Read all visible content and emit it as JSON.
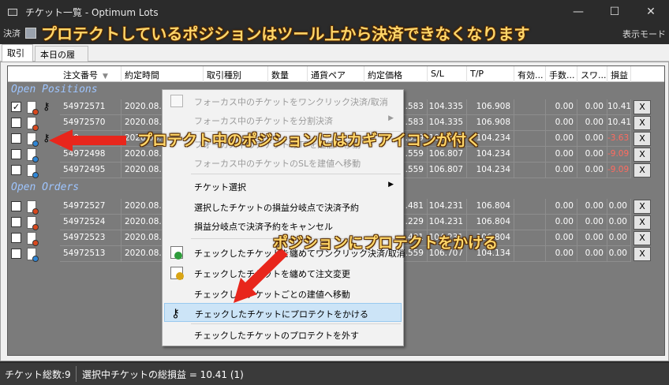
{
  "window": {
    "title": "チケット一覧 - Optimum Lots",
    "minimize": "—",
    "maximize": "☐",
    "close": "✕"
  },
  "toolbar": {
    "settle_label": "決済",
    "display_mode_label": "表示モード"
  },
  "banner_text": "プロテクトしているポジションはツール上から決済できなくなります",
  "tabs": [
    {
      "label": "取引",
      "active": true
    },
    {
      "label": "本日の履歴",
      "active": false
    }
  ],
  "columns": [
    "注文番号",
    "約定時間",
    "取引種別",
    "数量",
    "通貨ペア",
    "約定価格",
    "S/L",
    "T/P",
    "有効...",
    "手数...",
    "スワ...",
    "損益"
  ],
  "sections": {
    "open_positions": "Open Positions",
    "open_orders": "Open Orders"
  },
  "open_positions": [
    {
      "checked": true,
      "dot": "#d9481e",
      "key": true,
      "order": "54972571",
      "time": "2020.08.05",
      "price": ".583",
      "sl": "104.335",
      "tp": "106.908",
      "fee": "0.00",
      "swap": "0.00",
      "pl": "10.41",
      "neg": false
    },
    {
      "checked": false,
      "dot": "#d9481e",
      "key": false,
      "order": "54972570",
      "time": "2020.08.05",
      "price": ".583",
      "sl": "104.335",
      "tp": "106.908",
      "fee": "0.00",
      "swap": "0.00",
      "pl": "10.41",
      "neg": false
    },
    {
      "checked": false,
      "dot": "#2f86d6",
      "key": true,
      "order": "549",
      "time": "2020.08.05",
      "price": ".559",
      "sl": "106.807",
      "tp": "104.234",
      "fee": "0.00",
      "swap": "0.00",
      "pl": "-3.63",
      "neg": true
    },
    {
      "checked": false,
      "dot": "#2f86d6",
      "key": false,
      "order": "54972498",
      "time": "2020.08.05",
      "price": ".559",
      "sl": "106.807",
      "tp": "104.234",
      "fee": "0.00",
      "swap": "0.00",
      "pl": "-9.09",
      "neg": true
    },
    {
      "checked": false,
      "dot": "#2f86d6",
      "key": false,
      "order": "54972495",
      "time": "2020.08.05",
      "price": ".559",
      "sl": "106.807",
      "tp": "104.234",
      "fee": "0.00",
      "swap": "0.00",
      "pl": "-9.09",
      "neg": true
    }
  ],
  "open_orders": [
    {
      "checked": false,
      "dot": "#d9481e",
      "order": "54972527",
      "time": "2020.08.05",
      "price": ".481",
      "sl": "104.231",
      "tp": "106.804",
      "fee": "0.00",
      "swap": "0.00",
      "pl": "0.00"
    },
    {
      "checked": false,
      "dot": "#d9481e",
      "order": "54972524",
      "time": "2020.08.05",
      "price": ".229",
      "sl": "104.231",
      "tp": "106.804",
      "fee": "0.00",
      "swap": "0.00",
      "pl": "0.00"
    },
    {
      "checked": false,
      "dot": "#d9481e",
      "order": "54972523",
      "time": "2020.08.05",
      "price": ".481",
      "sl": "104.231",
      "tp": "106.804",
      "fee": "0.00",
      "swap": "0.00",
      "pl": "0.00"
    },
    {
      "checked": false,
      "dot": "#2f86d6",
      "order": "54972513",
      "time": "2020.08.05",
      "price": ".559",
      "sl": "106.707",
      "tp": "104.134",
      "fee": "0.00",
      "swap": "0.00",
      "pl": "0.00"
    }
  ],
  "close_button_label": "X",
  "context_menu": {
    "items": [
      {
        "label": "フォーカス中のチケットをワンクリック決済/取消",
        "disabled": true,
        "icon": "doc-icon"
      },
      {
        "label": "フォーカス中のチケットを分割決済",
        "disabled": true,
        "submenu": true
      },
      {
        "label": "フォーカス中のチケットのTPを建値へ移動",
        "disabled": true
      },
      {
        "label": "フォーカス中のチケットのSLを建値へ移動",
        "disabled": true
      },
      {
        "label": "チケット選択",
        "disabled": false,
        "submenu": true
      },
      {
        "label": "選択したチケットの損益分岐点で決済予約",
        "disabled": false
      },
      {
        "label": "損益分岐点で決済予約をキャンセル",
        "disabled": false
      },
      {
        "label": "チェックしたチケットを纏めてワンクリック決済/取消",
        "disabled": false,
        "icon": "doc-check-icon"
      },
      {
        "label": "チェックしたチケットを纏めて注文変更",
        "disabled": false,
        "icon": "doc-edit-icon"
      },
      {
        "label": "チェックしたチケットごとの建値へ移動",
        "disabled": false
      },
      {
        "label": "チェックしたチケットにプロテクトをかける",
        "disabled": false,
        "highlighted": true,
        "icon": "key-icon"
      },
      {
        "label": "チェックしたチケットのプロテクトを外す",
        "disabled": false
      }
    ]
  },
  "annotations": {
    "key_icon_note": "プロテクト中のポジションにはカギアイコンが付く",
    "protect_note": "ポジションにプロテクトをかける"
  },
  "status": {
    "ticket_count": "チケット総数:9",
    "selected_pl": "選択中チケットの総損益 = 10.41 (1)"
  },
  "colors": {
    "grid_bg": "#7b7b7b",
    "section_text": "#9ec5ff",
    "negative": "#ff6b60",
    "annotation": "#ffd76a",
    "arrow": "#e8261c",
    "highlight": "#cce4f7"
  }
}
